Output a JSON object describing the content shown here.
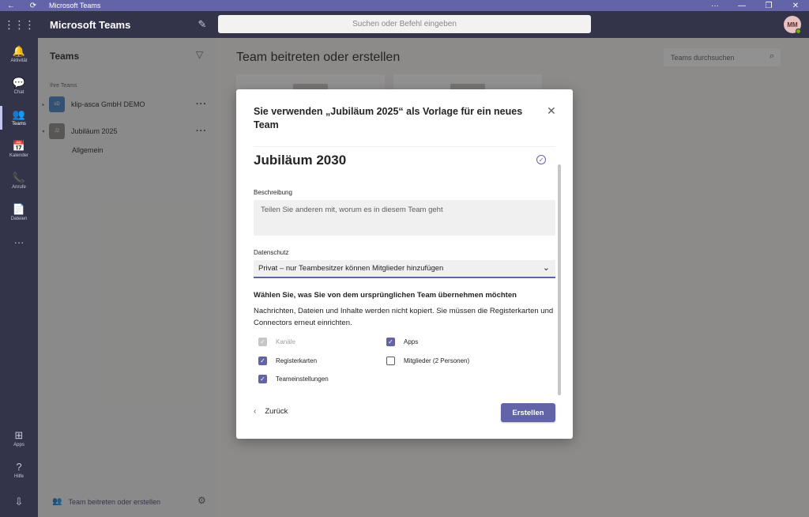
{
  "window": {
    "title": "Microsoft Teams",
    "back_icon": "←",
    "refresh_icon": "⟳",
    "more_icon": "···",
    "minimize_icon": "—",
    "restore_icon": "❐",
    "close_icon": "✕"
  },
  "header": {
    "app_name": "Microsoft Teams",
    "search_placeholder": "Suchen oder Befehl eingeben",
    "avatar_initials": "MM"
  },
  "rail": {
    "items": [
      {
        "label": "Aktivität",
        "icon": "🔔"
      },
      {
        "label": "Chat",
        "icon": "💬"
      },
      {
        "label": "Teams",
        "icon": "👥"
      },
      {
        "label": "Kalender",
        "icon": "📅"
      },
      {
        "label": "Anrufe",
        "icon": "📞"
      },
      {
        "label": "Dateien",
        "icon": "📄"
      },
      {
        "label": "",
        "icon": "···"
      },
      {
        "label": "Apps",
        "icon": "⊞"
      },
      {
        "label": "Hilfe",
        "icon": "?"
      },
      {
        "label": "",
        "icon": "⇩"
      }
    ]
  },
  "teams_panel": {
    "title": "Teams",
    "section": "Ihre Teams",
    "teams": [
      {
        "name": "klip-asca GmbH DEMO",
        "avatar": "sD",
        "color": "#3f7ec6"
      },
      {
        "name": "Jubiläum 2025",
        "avatar": "J2",
        "color": "#8a8886"
      }
    ],
    "channel": "Allgemein",
    "join_label": "Team beitreten oder erstellen"
  },
  "main": {
    "title": "Team beitreten oder erstellen",
    "search_placeholder": "Teams durchsuchen"
  },
  "dialog": {
    "title": "Sie verwenden „Jubiläum 2025“ als Vorlage für ein neues Team",
    "team_name": "Jubiläum 2030",
    "description_label": "Beschreibung",
    "description_placeholder": "Teilen Sie anderen mit, worum es in diesem Team geht",
    "privacy_label": "Datenschutz",
    "privacy_value": "Privat – nur Teambesitzer können Mitglieder hinzufügen",
    "copy_heading": "Wählen Sie, was Sie von dem ursprünglichen Team übernehmen möchten",
    "copy_text": "Nachrichten, Dateien und Inhalte werden nicht kopiert. Sie müssen die Registerkarten und Connectors erneut einrichten.",
    "options": [
      {
        "label": "Kanäle",
        "state": "disabled"
      },
      {
        "label": "Apps",
        "state": "checked"
      },
      {
        "label": "Registerkarten",
        "state": "checked"
      },
      {
        "label": "Mitglieder (2 Personen)",
        "state": "unchecked"
      },
      {
        "label": "Teameinstellungen",
        "state": "checked"
      }
    ],
    "back_label": "Zurück",
    "create_label": "Erstellen"
  },
  "colors": {
    "accent": "#6264a7",
    "rail": "#33344a"
  }
}
